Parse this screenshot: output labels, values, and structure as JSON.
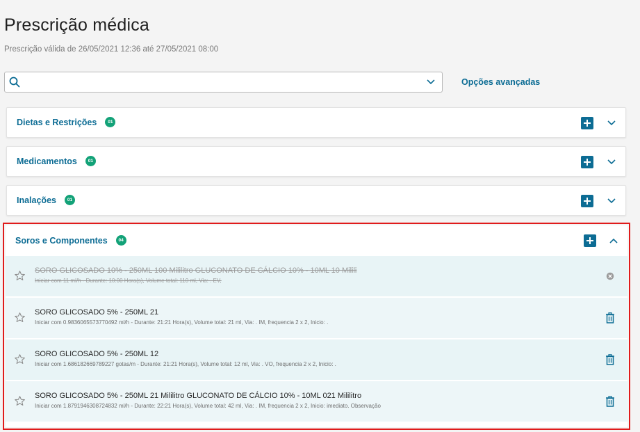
{
  "header": {
    "title": "Prescrição médica",
    "validity": "Prescrição válida de 26/05/2021 12:36 até 27/05/2021 08:00"
  },
  "search": {
    "value": "",
    "placeholder": "",
    "advanced_label": "Opções avançadas"
  },
  "sections": [
    {
      "label": "Dietas e Restrições",
      "count": "01",
      "expanded": false
    },
    {
      "label": "Medicamentos",
      "count": "01",
      "expanded": false
    },
    {
      "label": "Inalações",
      "count": "01",
      "expanded": false
    },
    {
      "label": "Soros e Componentes",
      "count": "04",
      "expanded": true
    }
  ],
  "soros_items": [
    {
      "name": "SORO GLICOSADO 10% - 250ML 100 Mililitro GLUCONATO DE CÁLCIO 10% - 10ML 10 Milili",
      "detail": "Iniciar com 11 ml/h - Durante: 10:00 Hora(s), Volume total: 110 ml, Via: . EV,",
      "suspended": true,
      "action_icon": "close-circle-icon"
    },
    {
      "name": "SORO GLICOSADO 5% - 250ML 21",
      "detail": "Iniciar com 0.9836065573770492 ml/h - Durante: 21:21 Hora(s), Volume total: 21 ml, Via: . IM, frequencia 2 x 2, Inicio: .",
      "suspended": false,
      "action_icon": "trash-icon"
    },
    {
      "name": "SORO GLICOSADO 5% - 250ML 12",
      "detail": "Iniciar com 1.686182669789227 gotas/m - Durante: 21:21 Hora(s), Volume total: 12 ml, Via: . VO, frequencia 2 x 2, Inicio: .",
      "suspended": false,
      "action_icon": "trash-icon"
    },
    {
      "name": "SORO GLICOSADO 5% - 250ML 21 Mililitro GLUCONATO DE CÁLCIO 10% - 10ML 021 Mililitro",
      "detail": "Iniciar com 1.8791946308724832 ml/h - Durante: 22:21 Hora(s), Volume total: 42 ml, Via: . IM, frequencia 2 x 2, Inicio: imediato. Observação",
      "suspended": false,
      "action_icon": "trash-icon"
    }
  ],
  "colors": {
    "accent": "#0c6c94",
    "badge": "#13a278",
    "highlight_border": "#e01b1b",
    "row_bg": "#e8f4f6"
  }
}
